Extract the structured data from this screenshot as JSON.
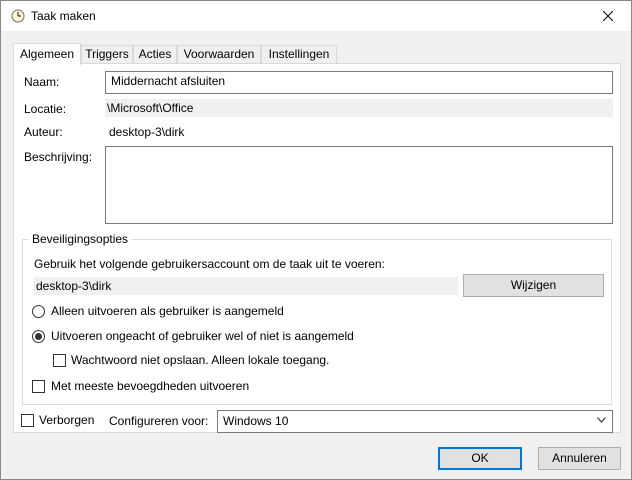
{
  "window": {
    "title": "Taak maken",
    "icon": "clock-icon",
    "close_icon": "close-icon"
  },
  "tabs": [
    {
      "label": "Algemeen",
      "active": true
    },
    {
      "label": "Triggers",
      "active": false
    },
    {
      "label": "Acties",
      "active": false
    },
    {
      "label": "Voorwaarden",
      "active": false
    },
    {
      "label": "Instellingen",
      "active": false
    }
  ],
  "general": {
    "name_label": "Naam:",
    "name_value": "Middernacht afsluiten",
    "location_label": "Locatie:",
    "location_value": "\\Microsoft\\Office",
    "author_label": "Auteur:",
    "author_value": "desktop-3\\dirk",
    "description_label": "Beschrijving:",
    "description_value": ""
  },
  "security": {
    "legend": "Beveiligingsopties",
    "account_prompt": "Gebruik het volgende gebruikersaccount om de taak uit te voeren:",
    "account_value": "desktop-3\\dirk",
    "change_button": "Wijzigen",
    "radio_logged_on": {
      "label": "Alleen uitvoeren als gebruiker is aangemeld",
      "checked": false
    },
    "radio_whether": {
      "label": "Uitvoeren ongeacht of gebruiker wel of niet is aangemeld",
      "checked": true
    },
    "checkbox_no_password": {
      "label": "Wachtwoord niet opslaan. Alleen lokale toegang.",
      "checked": false
    },
    "checkbox_highest": {
      "label": "Met meeste bevoegdheden uitvoeren",
      "checked": false
    }
  },
  "bottom": {
    "hidden_label": "Verborgen",
    "hidden_checked": false,
    "configure_label": "Configureren voor:",
    "configure_value": "Windows 10"
  },
  "buttons": {
    "ok": "OK",
    "cancel": "Annuleren"
  },
  "colors": {
    "accent": "#0078d7",
    "panel_border": "#d9d9d9",
    "readonly_bg": "#f0f0f0"
  }
}
